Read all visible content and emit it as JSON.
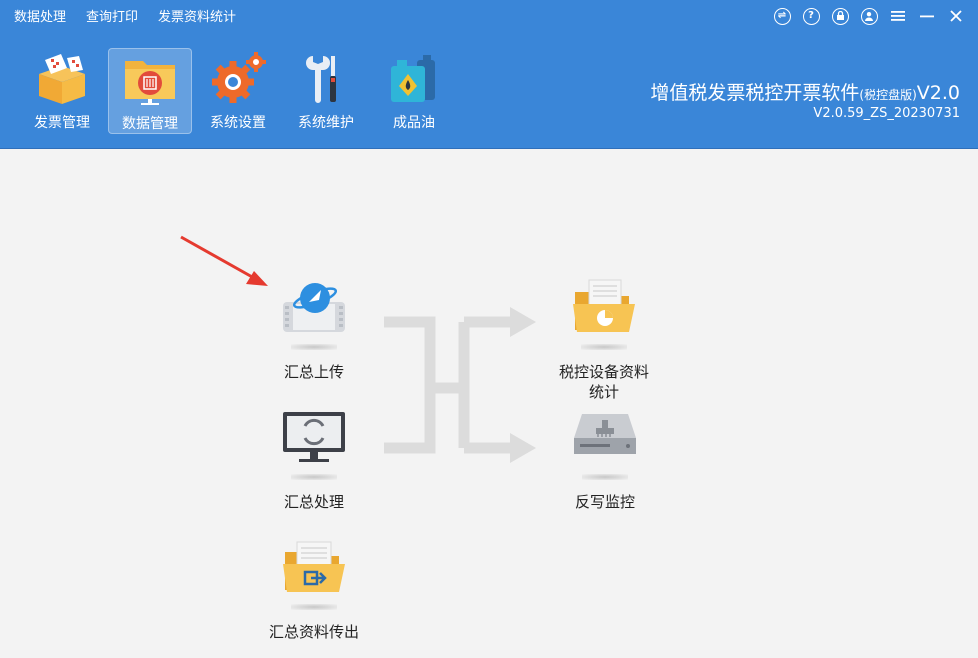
{
  "menu": {
    "items": [
      "数据处理",
      "查询打印",
      "发票资料统计"
    ]
  },
  "window_controls": [
    "exchange-icon",
    "help-icon",
    "lock-icon",
    "user-icon",
    "menu-icon",
    "minimize-icon",
    "close-icon"
  ],
  "toolbar": {
    "items": [
      {
        "label": "发票管理",
        "icon": "invoice-box-icon"
      },
      {
        "label": "数据管理",
        "icon": "data-folder-icon",
        "active": true
      },
      {
        "label": "系统设置",
        "icon": "gears-icon"
      },
      {
        "label": "系统维护",
        "icon": "tools-icon"
      },
      {
        "label": "成品油",
        "icon": "oil-can-icon"
      }
    ]
  },
  "app": {
    "title": "增值税发票税控开票软件",
    "edition": "(税控盘版)",
    "title_suffix": "V2.0",
    "version": "V2.0.59_ZS_20230731"
  },
  "flow": {
    "summary_upload": "汇总上传",
    "summary_process": "汇总处理",
    "summary_export": "汇总资料传出",
    "device_stats_line1": "税控设备资料",
    "device_stats_line2": "统计",
    "write_back_monitor": "反写监控"
  },
  "colors": {
    "header_bg": "#3a86d8",
    "page_bg": "#f3f3f3",
    "arrow": "#dcdcdc",
    "annotation_arrow": "#e53a2f"
  }
}
